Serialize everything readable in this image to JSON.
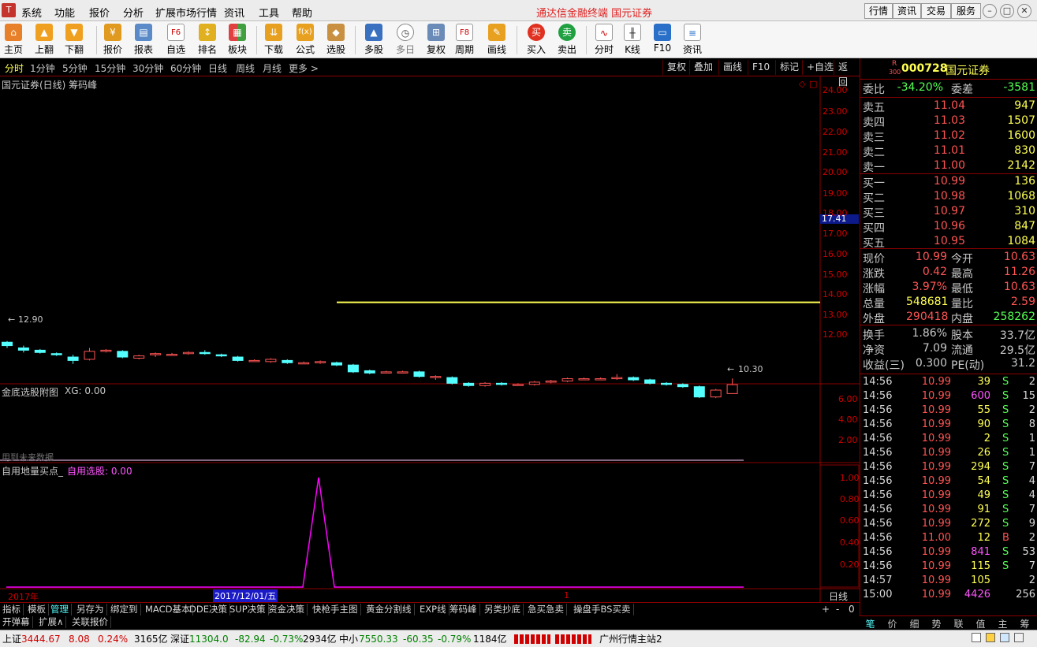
{
  "app": {
    "logo": "T",
    "title": "通达信金融终端  国元证券",
    "colors": {
      "bg": "#000000",
      "up": "#ff5454",
      "down": "#54ffff",
      "grid": "#8a0000",
      "yellow": "#ffff54",
      "magenta": "#ff00ff"
    }
  },
  "menu": [
    "系统",
    "功能",
    "报价",
    "分析",
    "扩展市场行情",
    "资讯",
    "工具",
    "帮助"
  ],
  "top_right_buttons": [
    "行情",
    "资讯",
    "交易",
    "服务"
  ],
  "toolbar": [
    {
      "label": "主页",
      "icon": "home-icon"
    },
    {
      "label": "上翻",
      "icon": "arrow-up-icon"
    },
    {
      "label": "下翻",
      "icon": "arrow-down-icon"
    },
    {
      "label": "报价",
      "icon": "yen-icon"
    },
    {
      "label": "报表",
      "icon": "report-icon"
    },
    {
      "label": "自选",
      "icon": "f6-icon"
    },
    {
      "label": "排名",
      "icon": "rank-icon"
    },
    {
      "label": "板块",
      "icon": "blocks-icon"
    },
    {
      "label": "下载",
      "icon": "download-icon"
    },
    {
      "label": "公式",
      "icon": "formula-icon"
    },
    {
      "label": "选股",
      "icon": "pick-icon"
    },
    {
      "label": "多股",
      "icon": "multi-stock-icon"
    },
    {
      "label": "多日",
      "icon": "clock-icon"
    },
    {
      "label": "复权",
      "icon": "restore-icon"
    },
    {
      "label": "周期",
      "icon": "f8-icon"
    },
    {
      "label": "画线",
      "icon": "draw-icon"
    },
    {
      "label": "买入",
      "icon": "buy-icon"
    },
    {
      "label": "卖出",
      "icon": "sell-icon"
    },
    {
      "label": "分时",
      "icon": "intraday-icon"
    },
    {
      "label": "K线",
      "icon": "kline-icon"
    },
    {
      "label": "F10",
      "icon": "f10-icon"
    },
    {
      "label": "资讯",
      "icon": "news-icon"
    }
  ],
  "toolbar_glyphs": {
    "buy": "买",
    "sell": "卖",
    "f6": "F6",
    "f8": "F8",
    "yen": "¥",
    "fx": "f(x)"
  },
  "periods": [
    "分时",
    "1分钟",
    "5分钟",
    "15分钟",
    "30分钟",
    "60分钟",
    "日线",
    "周线",
    "月线",
    "更多 >"
  ],
  "period_active": "分时",
  "chart_tools": [
    "复权",
    "叠加",
    "画线",
    "F10",
    "标记",
    "+自选",
    "返回"
  ],
  "main_chart": {
    "title": "国元证券(日线) 筹码峰",
    "price_axis": [
      "24.00",
      "23.00",
      "22.00",
      "21.00",
      "20.00",
      "19.00",
      "18.00",
      "17.00",
      "16.00",
      "15.00",
      "14.00",
      "13.00",
      "12.00"
    ],
    "current_price": "17.41",
    "high_label": "12.90",
    "low_label": "10.30",
    "arrow": "←"
  },
  "chart_data": {
    "type": "candlestick",
    "ylim": [
      11.2,
      24.5
    ],
    "ohlc": [
      [
        12.85,
        12.7,
        12.9,
        12.6
      ],
      [
        12.6,
        12.5,
        12.7,
        12.4
      ],
      [
        12.5,
        12.4,
        12.55,
        12.35
      ],
      [
        12.35,
        12.3,
        12.4,
        12.25
      ],
      [
        12.2,
        12.05,
        12.3,
        11.9
      ],
      [
        12.1,
        12.45,
        12.6,
        12.05
      ],
      [
        12.45,
        12.5,
        12.55,
        12.4
      ],
      [
        12.45,
        12.2,
        12.5,
        12.15
      ],
      [
        12.15,
        12.25,
        12.3,
        12.1
      ],
      [
        12.3,
        12.35,
        12.4,
        12.2
      ],
      [
        12.3,
        12.32,
        12.38,
        12.25
      ],
      [
        12.35,
        12.4,
        12.45,
        12.3
      ],
      [
        12.4,
        12.35,
        12.5,
        12.3
      ],
      [
        12.3,
        12.25,
        12.35,
        12.2
      ],
      [
        12.2,
        12.05,
        12.25,
        12.0
      ],
      [
        12.05,
        12.05,
        12.1,
        12.0
      ],
      [
        12.0,
        12.1,
        12.15,
        11.95
      ],
      [
        12.05,
        11.95,
        12.1,
        11.9
      ],
      [
        11.95,
        11.95,
        12.0,
        11.9
      ],
      [
        11.95,
        12.0,
        12.05,
        11.9
      ],
      [
        11.95,
        11.85,
        12.0,
        11.8
      ],
      [
        11.85,
        11.55,
        11.9,
        11.5
      ],
      [
        11.6,
        11.5,
        11.65,
        11.45
      ],
      [
        11.55,
        11.55,
        11.6,
        11.5
      ],
      [
        11.55,
        11.55,
        11.6,
        11.5
      ],
      [
        11.55,
        11.35,
        11.6,
        11.3
      ],
      [
        11.3,
        11.35,
        11.4,
        11.2
      ],
      [
        11.3,
        11.05,
        11.35,
        11.0
      ],
      [
        11.05,
        10.95,
        11.1,
        10.9
      ],
      [
        10.95,
        11.05,
        11.1,
        10.9
      ],
      [
        11.05,
        11.0,
        11.1,
        10.95
      ],
      [
        11.0,
        11.0,
        11.05,
        10.95
      ],
      [
        11.0,
        11.1,
        11.15,
        10.95
      ],
      [
        11.1,
        11.15,
        11.2,
        11.05
      ],
      [
        11.15,
        11.25,
        11.3,
        11.1
      ],
      [
        11.25,
        11.25,
        11.3,
        11.2
      ],
      [
        11.25,
        11.25,
        11.3,
        11.2
      ],
      [
        11.25,
        11.3,
        11.45,
        11.2
      ],
      [
        11.3,
        11.2,
        11.35,
        11.15
      ],
      [
        11.2,
        11.05,
        11.25,
        11.0
      ],
      [
        11.05,
        11.0,
        11.1,
        10.95
      ],
      [
        11.0,
        10.9,
        11.05,
        10.85
      ],
      [
        10.9,
        10.45,
        10.95,
        10.4
      ],
      [
        10.45,
        10.75,
        10.8,
        10.4
      ],
      [
        10.6,
        10.99,
        11.26,
        10.63
      ]
    ],
    "level_line": 14.6
  },
  "sub1": {
    "title": "金底选股附图",
    "label": "XG: 0.00",
    "axis": [
      "6.00",
      "4.00",
      "2.00"
    ],
    "note": "用到未来数据"
  },
  "sub2": {
    "title": "自用地量买点_",
    "label": "自用选股: 0.00",
    "axis": [
      "1.00",
      "0.80",
      "0.60",
      "0.40",
      "0.20"
    ]
  },
  "date_axis": {
    "year": "2017年",
    "cursor": "2017/12/01/五",
    "mark": "1",
    "period": "日线"
  },
  "quote": {
    "badge": "R",
    "badge_sub": "300",
    "code": "000728",
    "name": "国元证券",
    "weibi": {
      "label": "委比",
      "value": "-34.20%",
      "label2": "委差",
      "value2": "-3581"
    },
    "asks": [
      {
        "label": "卖五",
        "price": "11.04",
        "vol": "947"
      },
      {
        "label": "卖四",
        "price": "11.03",
        "vol": "1507"
      },
      {
        "label": "卖三",
        "price": "11.02",
        "vol": "1600"
      },
      {
        "label": "卖二",
        "price": "11.01",
        "vol": "830"
      },
      {
        "label": "卖一",
        "price": "11.00",
        "vol": "2142"
      }
    ],
    "bids": [
      {
        "label": "买一",
        "price": "10.99",
        "vol": "136"
      },
      {
        "label": "买二",
        "price": "10.98",
        "vol": "1068"
      },
      {
        "label": "买三",
        "price": "10.97",
        "vol": "310"
      },
      {
        "label": "买四",
        "price": "10.96",
        "vol": "847"
      },
      {
        "label": "买五",
        "price": "10.95",
        "vol": "1084"
      }
    ],
    "stats": [
      {
        "l1": "现价",
        "v1": "10.99",
        "l2": "今开",
        "v2": "10.63",
        "c1": "#ff5454",
        "c2": "#ff5454"
      },
      {
        "l1": "涨跌",
        "v1": "0.42",
        "l2": "最高",
        "v2": "11.26",
        "c1": "#ff5454",
        "c2": "#ff5454"
      },
      {
        "l1": "涨幅",
        "v1": "3.97%",
        "l2": "最低",
        "v2": "10.63",
        "c1": "#ff5454",
        "c2": "#ff5454"
      },
      {
        "l1": "总量",
        "v1": "548681",
        "l2": "量比",
        "v2": "2.59",
        "c1": "#ffff54",
        "c2": "#ff5454"
      },
      {
        "l1": "外盘",
        "v1": "290418",
        "l2": "内盘",
        "v2": "258262",
        "c1": "#ff5454",
        "c2": "#54ff54"
      }
    ],
    "stats2": [
      {
        "l1": "换手",
        "v1": "1.86%",
        "l2": "股本",
        "v2": "33.7亿"
      },
      {
        "l1": "净资",
        "v1": "7.09",
        "l2": "流通",
        "v2": "29.5亿"
      },
      {
        "l1": "收益(三)",
        "v1": "0.300",
        "l2": "PE(动)",
        "v2": "31.2"
      }
    ]
  },
  "ticks": [
    [
      "14:56",
      "10.99",
      "39",
      "S",
      "2"
    ],
    [
      "14:56",
      "10.99",
      "600",
      "S",
      "15"
    ],
    [
      "14:56",
      "10.99",
      "55",
      "S",
      "2"
    ],
    [
      "14:56",
      "10.99",
      "90",
      "S",
      "8"
    ],
    [
      "14:56",
      "10.99",
      "2",
      "S",
      "1"
    ],
    [
      "14:56",
      "10.99",
      "26",
      "S",
      "1"
    ],
    [
      "14:56",
      "10.99",
      "294",
      "S",
      "7"
    ],
    [
      "14:56",
      "10.99",
      "54",
      "S",
      "4"
    ],
    [
      "14:56",
      "10.99",
      "49",
      "S",
      "4"
    ],
    [
      "14:56",
      "10.99",
      "91",
      "S",
      "7"
    ],
    [
      "14:56",
      "10.99",
      "272",
      "S",
      "9"
    ],
    [
      "14:56",
      "11.00",
      "12",
      "B",
      "2"
    ],
    [
      "14:56",
      "10.99",
      "841",
      "S",
      "53"
    ],
    [
      "14:56",
      "10.99",
      "115",
      "S",
      "7"
    ],
    [
      "14:57",
      "10.99",
      "105",
      "",
      "2"
    ],
    [
      "15:00",
      "10.99",
      "4426",
      "",
      "256"
    ]
  ],
  "formula_tabs": [
    "指标",
    "模板",
    "管理",
    "另存为",
    "绑定到",
    "MACD基本",
    "DDE决策",
    "SUP决策",
    "资金决策",
    "快枪手主图",
    "黄金分割线",
    "EXP线",
    "筹码峰",
    "另类抄底",
    "急买急卖",
    "操盘手BS买卖"
  ],
  "formula_active": "管理",
  "formula_right": [
    "+",
    "-",
    "0"
  ],
  "sub_tabs": [
    "开弹幕",
    "扩展∧",
    "关联报价"
  ],
  "right_tabs": [
    "笔",
    "价",
    "细",
    "势",
    "联",
    "值",
    "主",
    "筹"
  ],
  "status": {
    "sh": {
      "label": "上证",
      "value": "3444.67",
      "chg": "8.08",
      "pct": "0.24%",
      "amt": "3165亿"
    },
    "sz": {
      "label": "深证",
      "value": "11304.0",
      "chg": "-82.94",
      "pct": "-0.73%",
      "amt": "2934亿"
    },
    "zx": {
      "label": "中小",
      "value": "7550.33",
      "chg": "-60.35",
      "pct": "-0.79%",
      "amt": "1184亿"
    },
    "server": "广州行情主站2"
  }
}
